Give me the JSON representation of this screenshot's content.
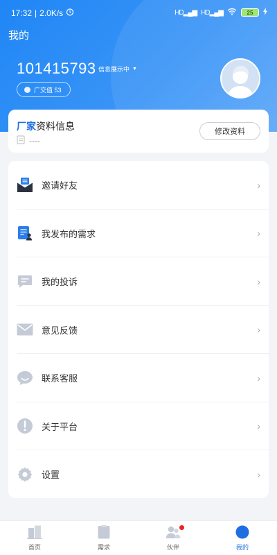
{
  "status": {
    "time": "17:32",
    "speed": "2.0K/s",
    "battery": "25",
    "signal_1": "HD",
    "signal_2": "HD"
  },
  "header": {
    "title": "我的",
    "user_id": "101415793",
    "status_label": "信息展示中",
    "badge": "广交值 53"
  },
  "info_card": {
    "title_highlight": "厂家",
    "title_rest": "资料信息",
    "subtitle": "----",
    "edit_button": "修改资料"
  },
  "menu": [
    {
      "label": "邀请好友",
      "icon": "invite-envelope-icon"
    },
    {
      "label": "我发布的需求",
      "icon": "published-demand-icon"
    },
    {
      "label": "我的投诉",
      "icon": "complaint-message-icon"
    },
    {
      "label": "意见反馈",
      "icon": "feedback-mail-icon"
    },
    {
      "label": "联系客服",
      "icon": "customer-service-chat-icon"
    },
    {
      "label": "关于平台",
      "icon": "info-exclamation-icon"
    },
    {
      "label": "设置",
      "icon": "settings-gear-icon"
    }
  ],
  "tabs": [
    {
      "label": "首页",
      "icon": "home-building-icon"
    },
    {
      "label": "需求",
      "icon": "demand-document-icon"
    },
    {
      "label": "伙伴",
      "icon": "partners-people-icon"
    },
    {
      "label": "我的",
      "icon": "profile-circle-icon"
    }
  ],
  "colors": {
    "primary": "#1f86f5",
    "accent_blue": "#1f6fe0",
    "icon_gray": "#c5cbd6",
    "badge_red": "#e22222"
  }
}
